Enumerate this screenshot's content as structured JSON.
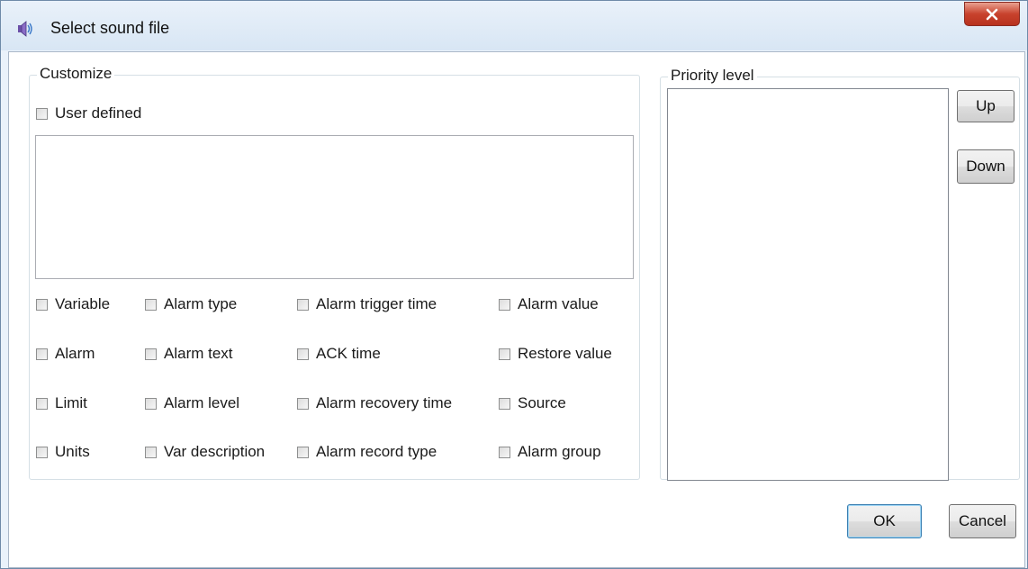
{
  "window": {
    "title": "Select sound file",
    "icon": "speaker-app-icon",
    "close_icon": "close-x-icon"
  },
  "customize": {
    "legend": "Customize",
    "user_defined_label": "User defined",
    "user_defined_checked": false,
    "text_value": "",
    "fields": [
      [
        "Variable",
        "Alarm type",
        "Alarm trigger time",
        "Alarm value"
      ],
      [
        "Alarm",
        "Alarm text",
        "ACK time",
        "Restore value"
      ],
      [
        "Limit",
        "Alarm level",
        "Alarm recovery time",
        "Source"
      ],
      [
        "Units",
        "Var description",
        "Alarm record type",
        "Alarm group"
      ]
    ]
  },
  "priority": {
    "legend": "Priority level",
    "items": [],
    "up_label": "Up",
    "down_label": "Down"
  },
  "footer": {
    "ok_label": "OK",
    "cancel_label": "Cancel"
  },
  "colors": {
    "title_bar": "#dce8f5",
    "close_button": "#c8422d",
    "default_button_border": "#3c7fb1"
  }
}
